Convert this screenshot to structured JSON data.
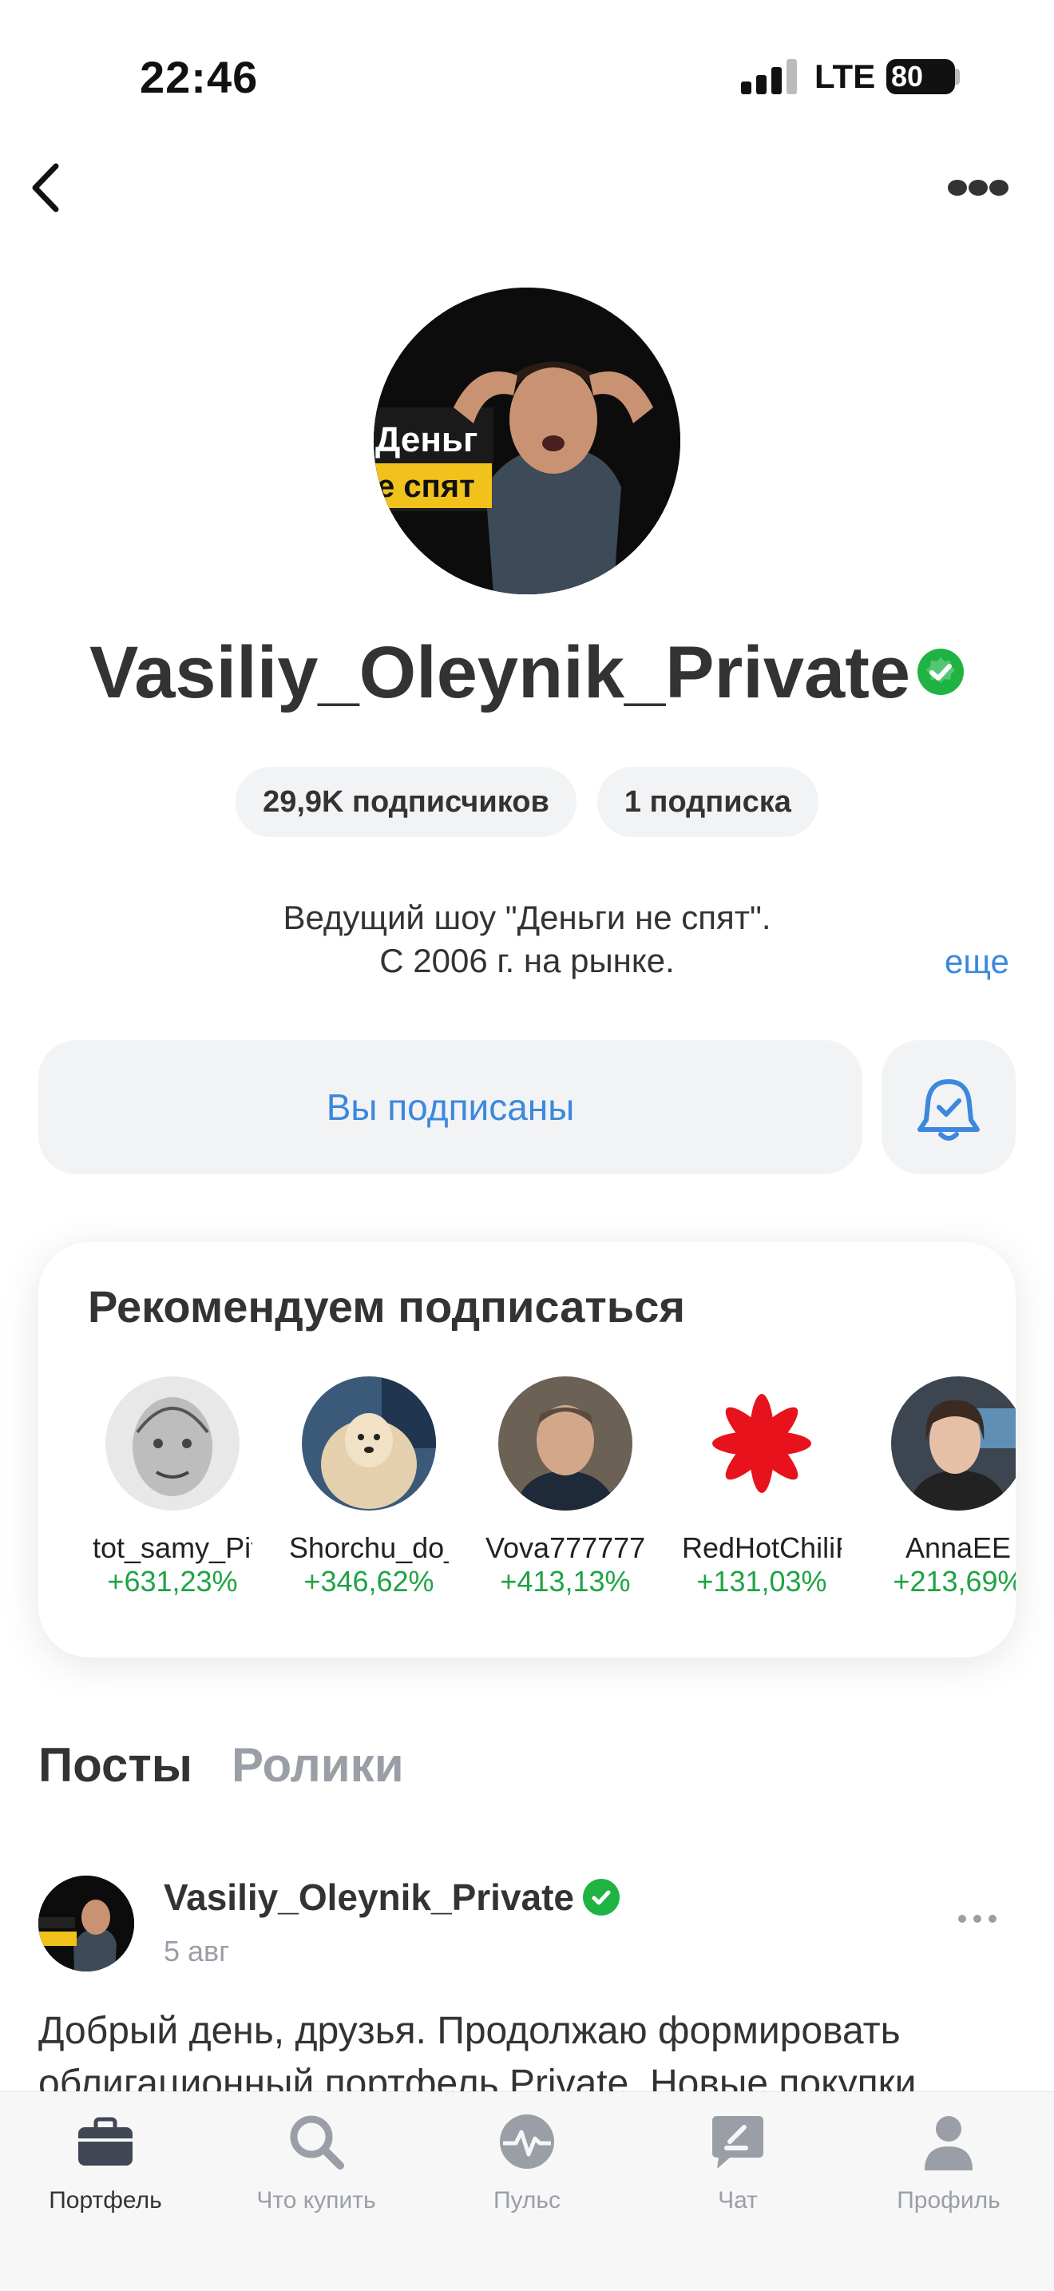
{
  "status_bar": {
    "time": "22:46",
    "network": "LTE",
    "battery": "80"
  },
  "profile": {
    "username": "Vasiliy_Oleynik_Private",
    "followers": "29,9K подписчиков",
    "following": "1 подписка",
    "bio_line1": "Ведущий шоу \"Деньги не спят\".",
    "bio_line2": "С 2006 г. на рынке.",
    "more_link": "еще",
    "subscribe_button": "Вы подписаны",
    "avatar_text_1": "Деньг",
    "avatar_text_2": "е спят"
  },
  "recommend": {
    "title": "Рекомендуем подписаться",
    "items": [
      {
        "name": "tot_samy_Pit",
        "gain": "+631,23%"
      },
      {
        "name": "Shorchu_do_",
        "gain": "+346,62%"
      },
      {
        "name": "Vova777777",
        "gain": "+413,13%"
      },
      {
        "name": "RedHotChiliP",
        "gain": "+131,03%"
      },
      {
        "name": "AnnaEE",
        "gain": "+213,69%"
      }
    ]
  },
  "tabs": {
    "posts": "Посты",
    "reels": "Ролики"
  },
  "post": {
    "author": "Vasiliy_Oleynik_Private",
    "date": "5 авг",
    "text": "Добрый день, друзья. Продолжаю формировать облигационный портфель Private. Новые покупки"
  },
  "bottom_nav": [
    {
      "label": "Портфель",
      "icon": "briefcase-icon"
    },
    {
      "label": "Что купить",
      "icon": "search-icon"
    },
    {
      "label": "Пульс",
      "icon": "pulse-icon"
    },
    {
      "label": "Чат",
      "icon": "chat-icon"
    },
    {
      "label": "Профиль",
      "icon": "profile-icon"
    }
  ],
  "colors": {
    "accent": "#3c88dd",
    "gain": "#1fa344",
    "verified": "#1fb344"
  }
}
